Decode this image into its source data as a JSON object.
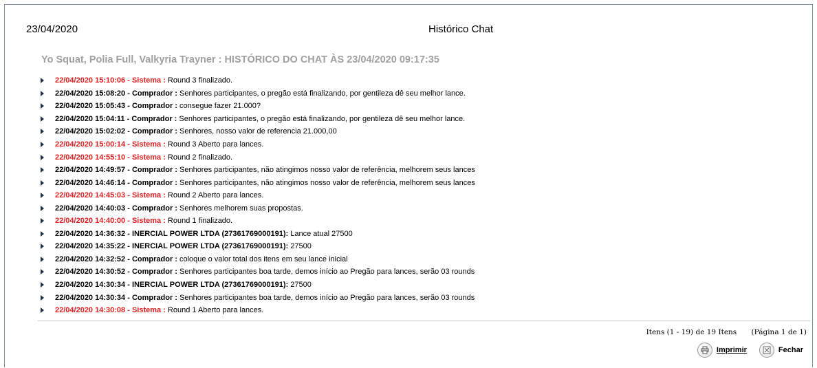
{
  "header": {
    "date": "23/04/2020",
    "title": "Histórico Chat"
  },
  "heading": "Yo Squat, Polia Full, Valkyria Trayner : HISTÓRICO DO CHAT ÀS 23/04/2020 09:17:35",
  "messages": [
    {
      "timestamp": "22/04/2020 15:10:06",
      "author": "Sistema",
      "text": "Round 3 finalizado.",
      "system": true
    },
    {
      "timestamp": "22/04/2020 15:08:20",
      "author": "Comprador",
      "text": "Senhores participantes, o pregão está finalizando, por gentileza dê seu melhor lance.",
      "system": false
    },
    {
      "timestamp": "22/04/2020 15:05:43",
      "author": "Comprador",
      "text": "consegue fazer 21.000?",
      "system": false
    },
    {
      "timestamp": "22/04/2020 15:04:11",
      "author": "Comprador",
      "text": "Senhores participantes, o pregão está finalizando, por gentileza dê seu melhor lance.",
      "system": false
    },
    {
      "timestamp": "22/04/2020 15:02:02",
      "author": "Comprador",
      "text": "Senhores, nosso valor de referencia 21.000,00",
      "system": false
    },
    {
      "timestamp": "22/04/2020 15:00:14",
      "author": "Sistema",
      "text": "Round 3 Aberto para lances.",
      "system": true
    },
    {
      "timestamp": "22/04/2020 14:55:10",
      "author": "Sistema",
      "text": "Round 2 finalizado.",
      "system": true
    },
    {
      "timestamp": "22/04/2020 14:49:57",
      "author": "Comprador",
      "text": "Senhores participantes, não atingimos nosso valor de referência, melhorem seus lances",
      "system": false
    },
    {
      "timestamp": "22/04/2020 14:46:14",
      "author": "Comprador",
      "text": "Senhores participantes, não atingimos nosso valor de referência, melhorem seus lances",
      "system": false
    },
    {
      "timestamp": "22/04/2020 14:45:03",
      "author": "Sistema",
      "text": "Round 2 Aberto para lances.",
      "system": true
    },
    {
      "timestamp": "22/04/2020 14:40:03",
      "author": "Comprador",
      "text": "Senhores melhorem suas propostas.",
      "system": false
    },
    {
      "timestamp": "22/04/2020 14:40:00",
      "author": "Sistema",
      "text": "Round 1 finalizado.",
      "system": true
    },
    {
      "timestamp": "22/04/2020 14:36:32",
      "author": "INERCIAL POWER LTDA (27361769000191)",
      "text": "Lance atual 27500",
      "system": false
    },
    {
      "timestamp": "22/04/2020 14:35:22",
      "author": "INERCIAL POWER LTDA (27361769000191)",
      "text": "27500",
      "system": false
    },
    {
      "timestamp": "22/04/2020 14:32:52",
      "author": "Comprador",
      "text": "coloque o valor total dos itens em seu lance inicial",
      "system": false
    },
    {
      "timestamp": "22/04/2020 14:30:52",
      "author": "Comprador",
      "text": "Senhores participantes boa tarde, demos início ao Pregão para lances, serão 03 rounds",
      "system": false
    },
    {
      "timestamp": "22/04/2020 14:30:34",
      "author": "INERCIAL POWER LTDA (27361769000191)",
      "text": "27500",
      "system": false
    },
    {
      "timestamp": "22/04/2020 14:30:34",
      "author": "Comprador",
      "text": "Senhores participantes boa tarde, demos início ao Pregão para lances, serão 03 rounds",
      "system": false
    },
    {
      "timestamp": "22/04/2020 14:30:08",
      "author": "Sistema",
      "text": "Round 1 Aberto para lances.",
      "system": true
    }
  ],
  "pager": {
    "items": "Itens (1 - 19) de 19 Itens",
    "page": "(Página 1 de 1)"
  },
  "actions": {
    "print_label": "Imprimir",
    "close_label": "Fechar",
    "print_icon": "printer-icon",
    "close_icon": "close-box-icon"
  },
  "colors": {
    "system_red": "#e02020",
    "heading_gray": "#a0a0a0",
    "arrow_navy": "#1b2f4a"
  }
}
